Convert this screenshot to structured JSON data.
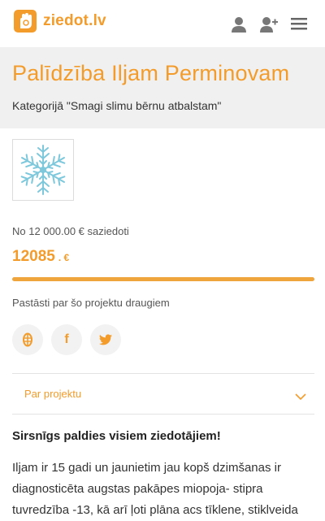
{
  "header": {
    "brand": "ziedot.lv",
    "icons": [
      "logo-hand-icon",
      "user-icon",
      "add-user-icon",
      "menu-icon"
    ]
  },
  "project": {
    "title": "Palīdzība Iljam Perminovam",
    "category": "Kategorijā \"Smagi slimu bērnu atbalstam\"",
    "image": "snowflake-image"
  },
  "funding": {
    "goal_text": "No 12 000.00 € saziedoti",
    "amount": "12085",
    "currency": ". €",
    "progress_fraction": 1.0
  },
  "share": {
    "label": "Pastāsti par šo projektu draugiem",
    "buttons": [
      "draugiem-icon",
      "facebook-icon",
      "twitter-icon"
    ]
  },
  "about": {
    "label": "Par projektu"
  },
  "content": {
    "thanks": "Sirsnīgs paldies visiem ziedotājiem!",
    "lines": [
      "Iljam ir 15 gadi un jaunietim jau kopš dzimšanas ir",
      "diagnosticēta augstas pakāpes miopoja- stipra",
      "tuvredzība -13, kā arī ļoti plāna acs tīklene, stiklveida"
    ]
  },
  "colors": {
    "accent": "#f39c2b",
    "band": "#f0f0f0",
    "snowflake": "#7ec8dc"
  }
}
